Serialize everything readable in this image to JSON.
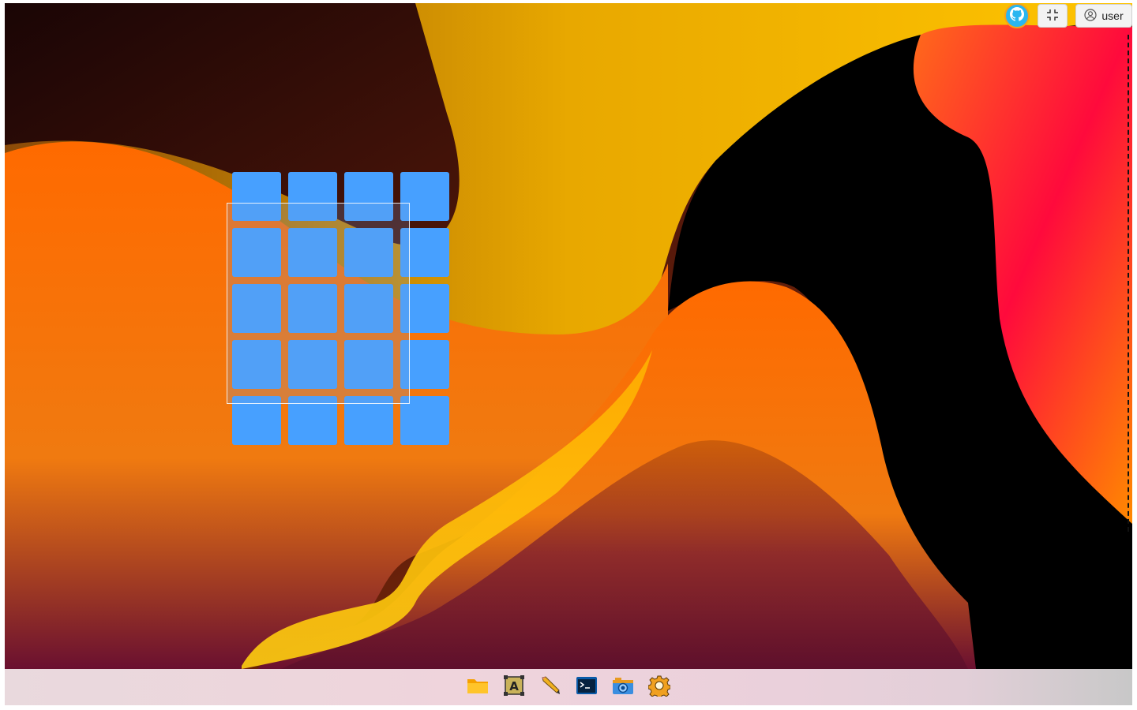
{
  "topbar": {
    "github_icon": "github-octocat-icon",
    "exit_fullscreen_icon": "exit-fullscreen-icon",
    "user_icon": "user-circle-icon",
    "user_label": "user"
  },
  "desktop": {
    "tile_grid": {
      "rows": 5,
      "columns": 4,
      "tile_color": "#47a0ff"
    }
  },
  "dock": {
    "items": [
      {
        "name": "file-manager",
        "icon": "folder-icon"
      },
      {
        "name": "text-editor",
        "icon": "text-editor-icon"
      },
      {
        "name": "draw",
        "icon": "pencil-icon"
      },
      {
        "name": "terminal",
        "icon": "terminal-icon"
      },
      {
        "name": "screenshot",
        "icon": "camera-icon"
      },
      {
        "name": "settings",
        "icon": "gear-icon"
      }
    ]
  },
  "colors": {
    "accent_blue": "#47a0ff",
    "github_blue": "#2bb6f0",
    "wallpaper_orange": "#ff6a00",
    "wallpaper_yellow": "#ffc400",
    "wallpaper_red": "#ff0a3c"
  }
}
